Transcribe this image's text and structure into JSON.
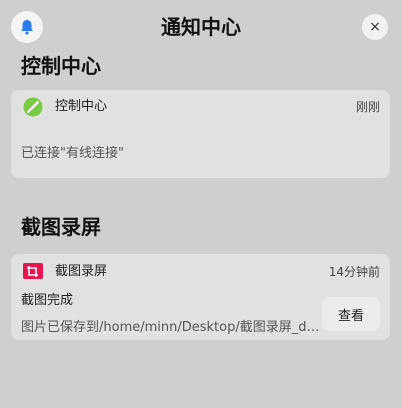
{
  "header": {
    "title": "通知中心",
    "close_label": "×"
  },
  "sections": [
    {
      "title": "控制中心",
      "app_name": "控制中心",
      "time": "刚刚",
      "body": "已连接\"有线连接\"",
      "icon": "control-center-icon"
    },
    {
      "title": "截图录屏",
      "app_name": "截图录屏",
      "time": "14分钟前",
      "body_title": "截图完成",
      "body": "图片已保存到/home/minn/Desktop/截图录屏_d…",
      "action_label": "查看",
      "icon": "screenshot-icon"
    }
  ],
  "colors": {
    "background": "#cfcfcf",
    "card": "#e1e1e1",
    "accent_blue": "#2a7cf0",
    "control_center_green": "#7ac943",
    "screenshot_red": "#e8134f"
  }
}
